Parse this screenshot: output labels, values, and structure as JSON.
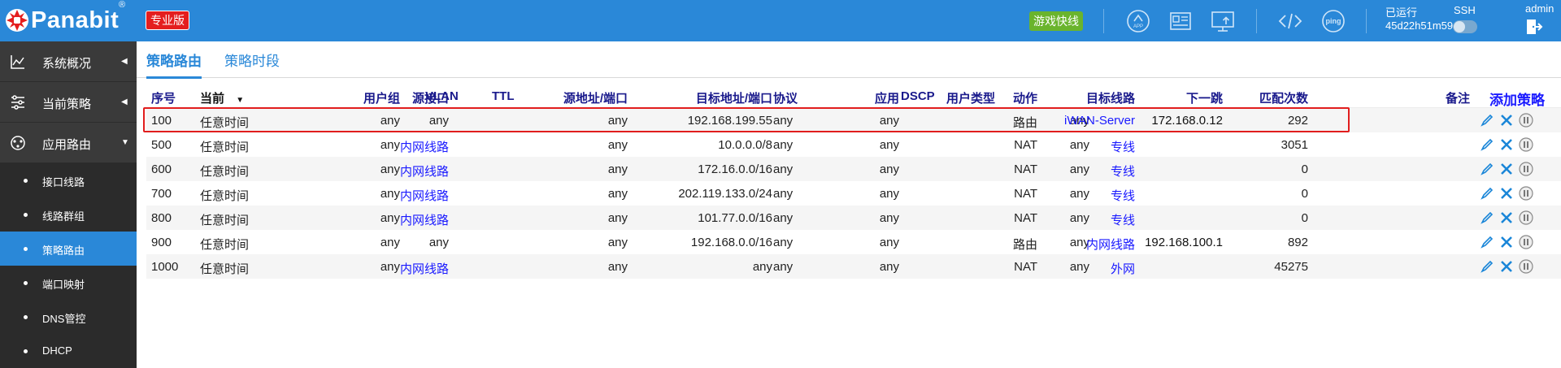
{
  "header": {
    "logo_text": "Panabit",
    "logo_reg": "®",
    "edition": "专业版",
    "game_button": "游戏快线",
    "uptime_label": "已运行",
    "uptime_value": "45d22h51m59s",
    "ssh_label": "SSH",
    "user": "admin",
    "icons": [
      "app-icon",
      "dashboard-icon",
      "monitor-upload-icon",
      "code-icon",
      "ping-icon",
      "logout-icon"
    ],
    "ping_text": "ping",
    "app_text": "APP"
  },
  "sidebar": {
    "items": [
      {
        "label": "系统概况",
        "icon": "chart-line-icon",
        "expanded": false
      },
      {
        "label": "当前策略",
        "icon": "sliders-icon",
        "expanded": false
      },
      {
        "label": "应用路由",
        "icon": "route-icon",
        "expanded": true
      }
    ],
    "subitems": [
      {
        "label": "接口线路",
        "active": false
      },
      {
        "label": "线路群组",
        "active": false
      },
      {
        "label": "策略路由",
        "active": true
      },
      {
        "label": "端口映射",
        "active": false
      },
      {
        "label": "DNS管控",
        "active": false
      },
      {
        "label": "DHCP",
        "active": false
      }
    ]
  },
  "tabs": [
    {
      "label": "策略路由",
      "active": true
    },
    {
      "label": "策略时段",
      "active": false
    }
  ],
  "table": {
    "columns": {
      "seq": "序号",
      "schedule": "当前",
      "usergroup": "用户组",
      "src_if": "源接口",
      "vlan": "VLAN",
      "ttl": "TTL",
      "src_addr": "源地址/端口",
      "dst_addr": "目标地址/端口",
      "proto": "协议",
      "app": "应用",
      "dscp": "DSCP",
      "usertype": "用户类型",
      "action": "动作",
      "target": "目标线路",
      "nexthop": "下一跳",
      "matches": "匹配次数",
      "note": "备注"
    },
    "add_label": "添加策略",
    "rows": [
      {
        "seq": "100",
        "schedule": "任意时间",
        "usergroup": "any",
        "src_if": "any",
        "src_if_link": false,
        "src_addr": "any",
        "dst_addr": "192.168.199.55",
        "proto": "any",
        "app": "any",
        "usertype": "any",
        "action": "路由",
        "target": "iWAN-Server",
        "nexthop": "172.168.0.12",
        "matches": "292"
      },
      {
        "seq": "500",
        "schedule": "任意时间",
        "usergroup": "any",
        "src_if": "内网线路",
        "src_if_link": true,
        "src_addr": "any",
        "dst_addr": "10.0.0.0/8",
        "proto": "any",
        "app": "any",
        "usertype": "any",
        "action": "NAT",
        "target": "专线",
        "nexthop": "",
        "matches": "3051"
      },
      {
        "seq": "600",
        "schedule": "任意时间",
        "usergroup": "any",
        "src_if": "内网线路",
        "src_if_link": true,
        "src_addr": "any",
        "dst_addr": "172.16.0.0/16",
        "proto": "any",
        "app": "any",
        "usertype": "any",
        "action": "NAT",
        "target": "专线",
        "nexthop": "",
        "matches": "0"
      },
      {
        "seq": "700",
        "schedule": "任意时间",
        "usergroup": "any",
        "src_if": "内网线路",
        "src_if_link": true,
        "src_addr": "any",
        "dst_addr": "202.119.133.0/24",
        "proto": "any",
        "app": "any",
        "usertype": "any",
        "action": "NAT",
        "target": "专线",
        "nexthop": "",
        "matches": "0"
      },
      {
        "seq": "800",
        "schedule": "任意时间",
        "usergroup": "any",
        "src_if": "内网线路",
        "src_if_link": true,
        "src_addr": "any",
        "dst_addr": "101.77.0.0/16",
        "proto": "any",
        "app": "any",
        "usertype": "any",
        "action": "NAT",
        "target": "专线",
        "nexthop": "",
        "matches": "0"
      },
      {
        "seq": "900",
        "schedule": "任意时间",
        "usergroup": "any",
        "src_if": "any",
        "src_if_link": false,
        "src_addr": "any",
        "dst_addr": "192.168.0.0/16",
        "proto": "any",
        "app": "any",
        "usertype": "any",
        "action": "路由",
        "target": "内网线路",
        "nexthop": "192.168.100.1",
        "matches": "892"
      },
      {
        "seq": "1000",
        "schedule": "任意时间",
        "usergroup": "any",
        "src_if": "内网线路",
        "src_if_link": true,
        "src_addr": "any",
        "dst_addr": "any",
        "proto": "any",
        "app": "any",
        "usertype": "any",
        "action": "NAT",
        "target": "外网",
        "nexthop": "",
        "matches": "45275"
      }
    ],
    "row_actions": [
      "edit-icon",
      "delete-icon",
      "pause-icon"
    ]
  },
  "colors": {
    "topbar": "#2a88d8",
    "sidebar": "#3a3a3a",
    "active": "#2a88d8",
    "link": "#1a1aff",
    "highlight": "#e11d1d",
    "edition": "#e41e1e",
    "game": "#6ab42d"
  }
}
